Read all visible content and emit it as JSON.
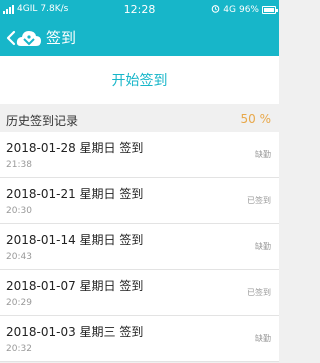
{
  "status_bar": {
    "left_text": "4GIL",
    "speed": "7.8K/s",
    "time": "12:28",
    "network": "4G",
    "battery": "96%",
    "battery_level": 0.96
  },
  "header": {
    "title": "签到"
  },
  "start_button": {
    "label": "开始签到"
  },
  "history": {
    "title": "历史签到记录",
    "percent": "50 %"
  },
  "records": [
    {
      "date": "2018-01-28 星期日 签到",
      "time": "21:38",
      "status": "缺勤"
    },
    {
      "date": "2018-01-21 星期日 签到",
      "time": "20:30",
      "status": "已签到"
    },
    {
      "date": "2018-01-14 星期日 签到",
      "time": "20:43",
      "status": "缺勤"
    },
    {
      "date": "2018-01-07 星期日 签到",
      "time": "20:29",
      "status": "已签到"
    },
    {
      "date": "2018-01-03 星期三 签到",
      "time": "20:32",
      "status": "缺勤"
    }
  ],
  "colors": {
    "accent": "#17b6c9",
    "percent": "#e8a84a"
  },
  "icons": [
    "back-icon",
    "app-logo",
    "alarm-icon",
    "signal-icon",
    "battery-icon"
  ]
}
